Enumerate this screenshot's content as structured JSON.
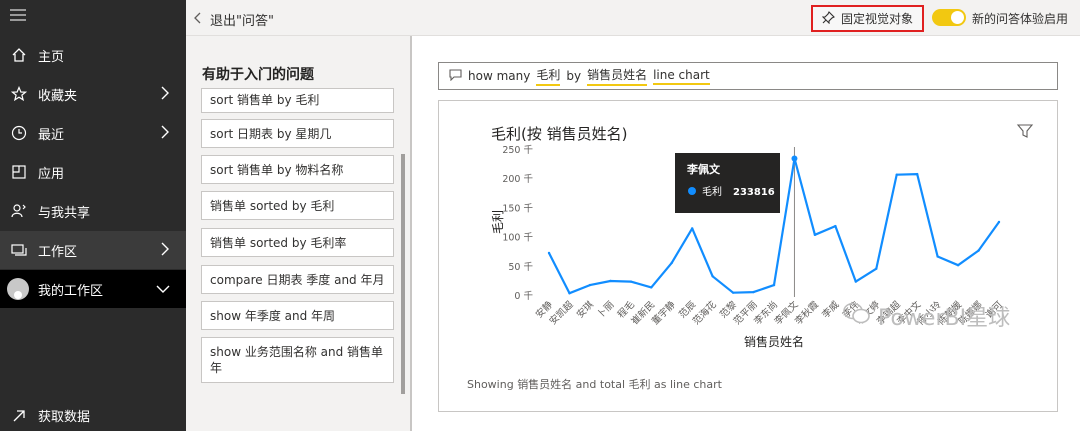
{
  "nav": {
    "items": [
      {
        "label": "主页"
      },
      {
        "label": "收藏夹"
      },
      {
        "label": "最近"
      },
      {
        "label": "应用"
      },
      {
        "label": "与我共享"
      },
      {
        "label": "工作区"
      },
      {
        "label": "我的工作区"
      },
      {
        "label": "获取数据"
      }
    ]
  },
  "topbar": {
    "back_label": "退出\"问答\"",
    "pin_label": "固定视觉对象",
    "toggle_label": "新的问答体验启用"
  },
  "suggestions": {
    "title": "有助于入门的问题",
    "items": [
      "sort 销售单 by 毛利",
      "sort 日期表 by 星期几",
      "sort 销售单 by 物料名称",
      "销售单 sorted by 毛利",
      "销售单 sorted by 毛利率",
      "compare 日期表 季度 and 年月",
      "show 年季度 and 年周",
      "show 业务范围名称 and 销售单年"
    ]
  },
  "question": {
    "prefix": "how many",
    "t1": "毛利",
    "mid": "by",
    "t2": "销售员姓名",
    "t3": "line chart"
  },
  "chart_data": {
    "type": "line",
    "title": "毛利(按 销售员姓名)",
    "xlabel": "销售员姓名",
    "ylabel": "毛利",
    "ylim": [
      0,
      250000
    ],
    "yticks": [
      {
        "v": 0,
        "label": "0 千"
      },
      {
        "v": 50000,
        "label": "50 千"
      },
      {
        "v": 100000,
        "label": "100 千"
      },
      {
        "v": 150000,
        "label": "150 千"
      },
      {
        "v": 200000,
        "label": "200 千"
      },
      {
        "v": 250000,
        "label": "250 千"
      }
    ],
    "categories": [
      "安静",
      "安凯超",
      "安琪",
      "卜丽",
      "程毛",
      "崔新民",
      "董宇静",
      "范辰",
      "范海花",
      "范黎",
      "范平丽",
      "李东尚",
      "李佩文",
      "李秋霞",
      "李威",
      "李伟",
      "李文婷",
      "李锦超",
      "李中文",
      "陈小玲",
      "陈朝媛",
      "陈娜娜",
      "谢可"
    ],
    "series": [
      {
        "name": "毛利",
        "values": [
          72000,
          3000,
          17000,
          24000,
          23000,
          13000,
          55000,
          114000,
          32000,
          4000,
          5000,
          17000,
          233816,
          103000,
          118000,
          23000,
          45000,
          206000,
          207000,
          66000,
          51000,
          76000,
          125000
        ]
      }
    ],
    "tooltip": {
      "name": "李佩文",
      "metric": "毛利",
      "value": "233816"
    },
    "highlight_index": 12,
    "filter_icon": "filter-icon",
    "line_color": "#118dff"
  },
  "card": {
    "footnote": "Showing 销售员姓名 and total 毛利 as line chart"
  },
  "watermark": {
    "text": "PowerBI星球"
  }
}
